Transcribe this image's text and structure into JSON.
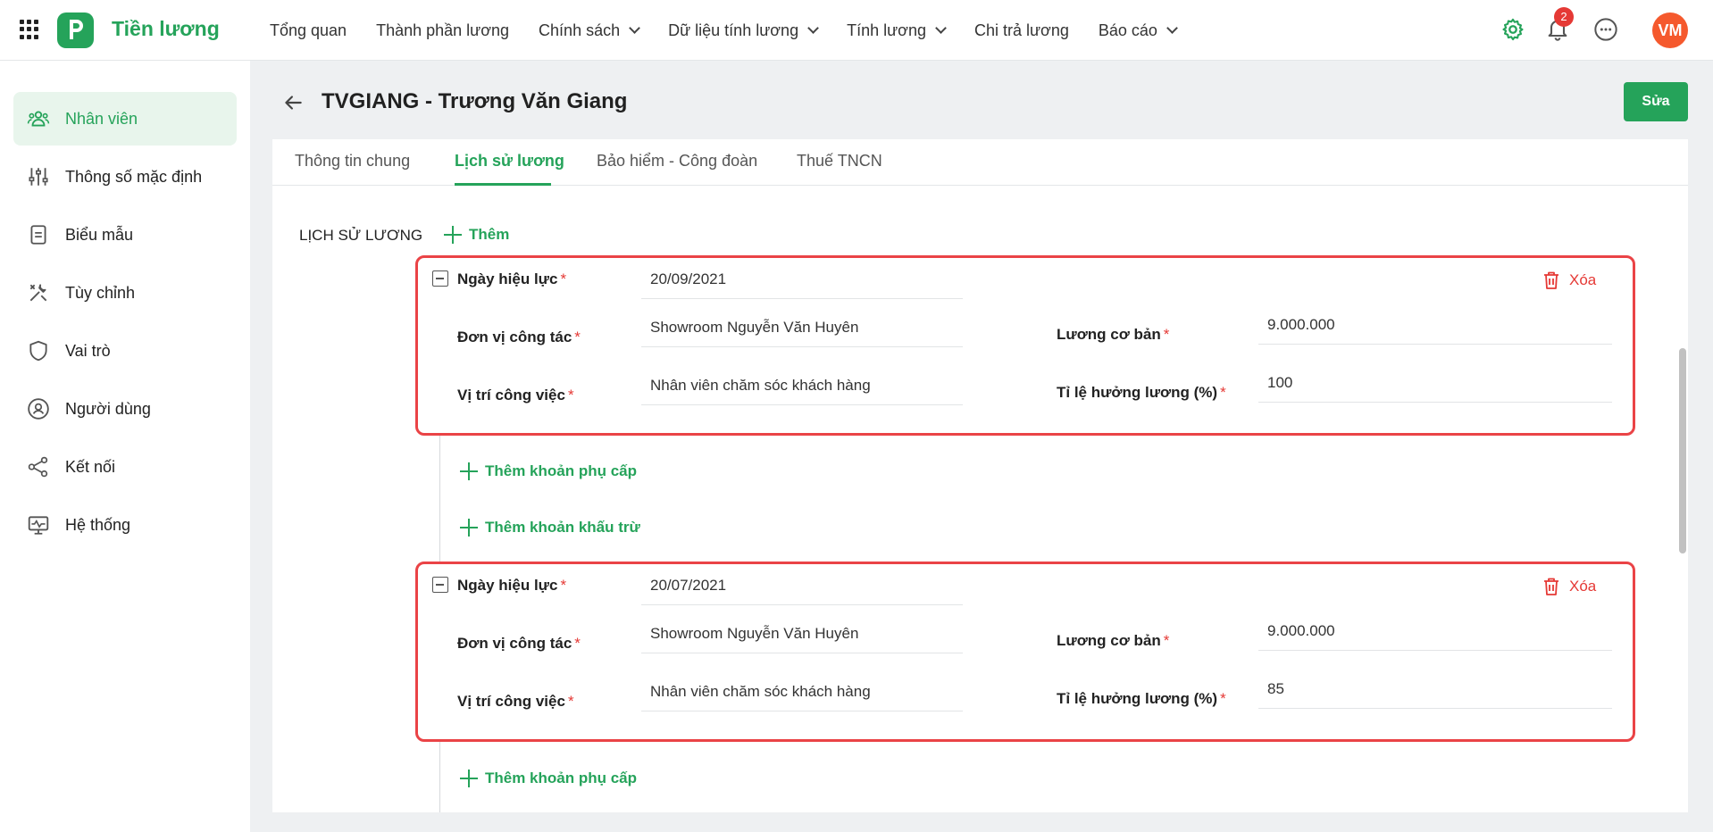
{
  "app": {
    "title": "Tiền lương",
    "avatar_initials": "VM",
    "notification_count": "2"
  },
  "nav": [
    {
      "label": "Tổng quan"
    },
    {
      "label": "Thành phần lương"
    },
    {
      "label": "Chính sách"
    },
    {
      "label": "Dữ liệu tính lương"
    },
    {
      "label": "Tính lương"
    },
    {
      "label": "Chi trả lương"
    },
    {
      "label": "Báo cáo"
    }
  ],
  "sidebar": {
    "items": [
      {
        "label": "Nhân viên",
        "icon": "people-icon",
        "active": true
      },
      {
        "label": "Thông số mặc định",
        "icon": "sliders-icon"
      },
      {
        "label": "Biểu mẫu",
        "icon": "document-icon"
      },
      {
        "label": "Tùy chỉnh",
        "icon": "tools-icon"
      },
      {
        "label": "Vai trò",
        "icon": "shield-icon"
      },
      {
        "label": "Người dùng",
        "icon": "user-circle-icon"
      },
      {
        "label": "Kết nối",
        "icon": "share-icon"
      },
      {
        "label": "Hệ thống",
        "icon": "monitor-icon"
      }
    ]
  },
  "page": {
    "title": "TVGIANG - Trương Văn Giang",
    "edit_label": "Sửa"
  },
  "tabs": [
    {
      "label": "Thông tin chung"
    },
    {
      "label": "Lịch sử lương",
      "active": true
    },
    {
      "label": "Bảo hiểm - Công đoàn"
    },
    {
      "label": "Thuế TNCN"
    }
  ],
  "history": {
    "section_title": "LỊCH SỬ LƯƠNG",
    "add_label": "Thêm",
    "add_allowance_label": "Thêm khoản phụ cấp",
    "add_deduction_label": "Thêm khoản khấu trừ",
    "delete_label": "Xóa",
    "labels": {
      "effective_date": "Ngày hiệu lực",
      "unit": "Đơn vị công tác",
      "position": "Vị trí công việc",
      "base_salary": "Lương cơ bản",
      "rate": "Tỉ lệ hưởng lương (%)"
    },
    "records": [
      {
        "effective_date": "20/09/2021",
        "unit": "Showroom Nguyễn Văn Huyên",
        "position": "Nhân viên chăm sóc khách hàng",
        "base_salary": "9.000.000",
        "rate": "100"
      },
      {
        "effective_date": "20/07/2021",
        "unit": "Showroom Nguyễn Văn Huyên",
        "position": "Nhân viên chăm sóc khách hàng",
        "base_salary": "9.000.000",
        "rate": "85"
      }
    ]
  },
  "colors": {
    "brand": "#25a35a",
    "danger": "#e53935",
    "highlight_border": "#ea4346",
    "avatar": "#f5592d"
  }
}
